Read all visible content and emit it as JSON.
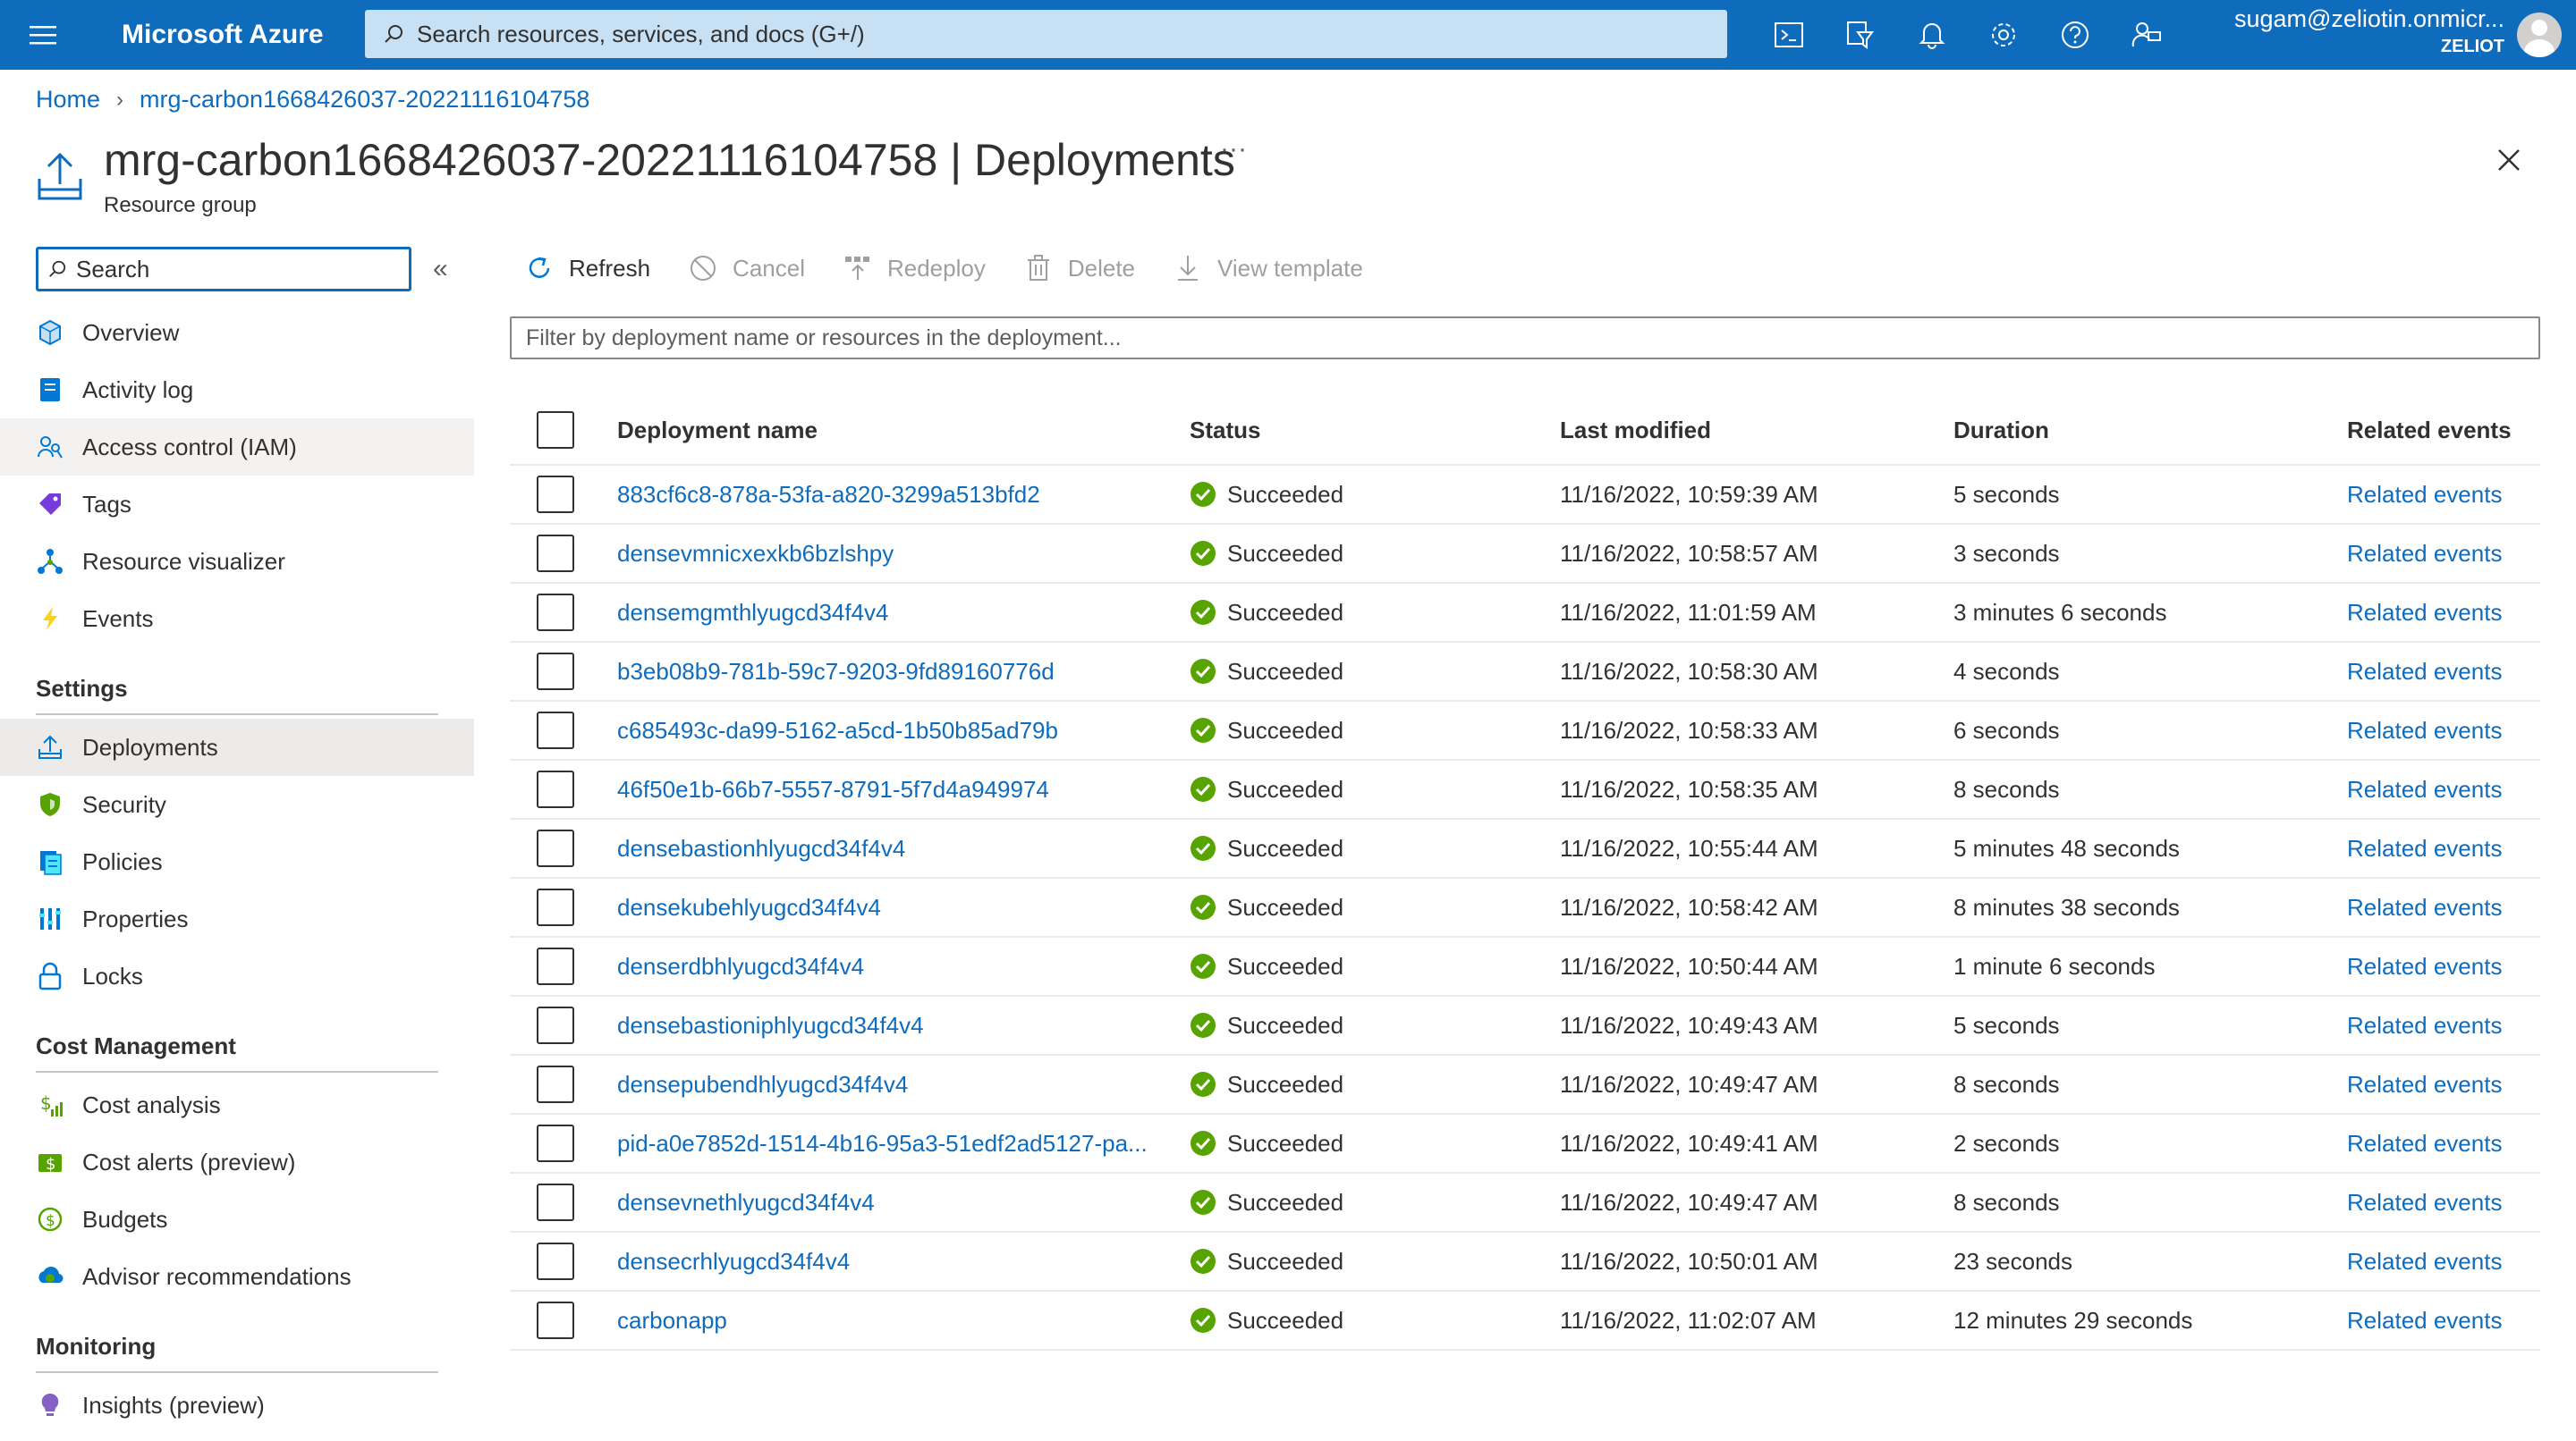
{
  "topbar": {
    "brand": "Microsoft Azure",
    "search_placeholder": "Search resources, services, and docs (G+/)",
    "icons": [
      "cloud-shell-icon",
      "directory-filter-icon",
      "notifications-icon",
      "settings-icon",
      "help-icon",
      "feedback-icon"
    ],
    "account_email": "sugam@zeliotin.onmicr...",
    "account_tenant": "ZELIOT"
  },
  "breadcrumb": {
    "home": "Home",
    "current": "mrg-carbon1668426037-20221116104758"
  },
  "header": {
    "title": "mrg-carbon1668426037-20221116104758 | Deployments",
    "subtitle": "Resource group",
    "more": "···"
  },
  "nav": {
    "search_placeholder": "Search",
    "collapse": "«",
    "items_top": [
      {
        "label": "Overview",
        "icon": "overview-icon"
      },
      {
        "label": "Activity log",
        "icon": "activity-log-icon"
      },
      {
        "label": "Access control (IAM)",
        "icon": "iam-icon"
      },
      {
        "label": "Tags",
        "icon": "tag-icon"
      },
      {
        "label": "Resource visualizer",
        "icon": "visualizer-icon"
      },
      {
        "label": "Events",
        "icon": "lightning-icon"
      }
    ],
    "settings_title": "Settings",
    "items_settings": [
      {
        "label": "Deployments",
        "icon": "deployments-icon"
      },
      {
        "label": "Security",
        "icon": "shield-icon"
      },
      {
        "label": "Policies",
        "icon": "policy-icon"
      },
      {
        "label": "Properties",
        "icon": "properties-icon"
      },
      {
        "label": "Locks",
        "icon": "lock-icon"
      }
    ],
    "cost_title": "Cost Management",
    "items_cost": [
      {
        "label": "Cost analysis",
        "icon": "cost-analysis-icon"
      },
      {
        "label": "Cost alerts (preview)",
        "icon": "cost-alerts-icon"
      },
      {
        "label": "Budgets",
        "icon": "budgets-icon"
      },
      {
        "label": "Advisor recommendations",
        "icon": "advisor-icon"
      }
    ],
    "monitoring_title": "Monitoring",
    "items_monitoring": [
      {
        "label": "Insights (preview)",
        "icon": "insights-icon"
      }
    ]
  },
  "toolbar": {
    "refresh": "Refresh",
    "cancel": "Cancel",
    "redeploy": "Redeploy",
    "delete": "Delete",
    "view_template": "View template"
  },
  "filter_placeholder": "Filter by deployment name or resources in the deployment...",
  "table": {
    "columns": [
      "Deployment name",
      "Status",
      "Last modified",
      "Duration",
      "Related events"
    ],
    "rows": [
      {
        "name": "883cf6c8-878a-53fa-a820-3299a513bfd2",
        "status": "Succeeded",
        "modified": "11/16/2022, 10:59:39 AM",
        "duration": "5 seconds",
        "events": "Related events"
      },
      {
        "name": "densevmnicxexkb6bzlshpy",
        "status": "Succeeded",
        "modified": "11/16/2022, 10:58:57 AM",
        "duration": "3 seconds",
        "events": "Related events"
      },
      {
        "name": "densemgmthlyugcd34f4v4",
        "status": "Succeeded",
        "modified": "11/16/2022, 11:01:59 AM",
        "duration": "3 minutes 6 seconds",
        "events": "Related events"
      },
      {
        "name": "b3eb08b9-781b-59c7-9203-9fd89160776d",
        "status": "Succeeded",
        "modified": "11/16/2022, 10:58:30 AM",
        "duration": "4 seconds",
        "events": "Related events"
      },
      {
        "name": "c685493c-da99-5162-a5cd-1b50b85ad79b",
        "status": "Succeeded",
        "modified": "11/16/2022, 10:58:33 AM",
        "duration": "6 seconds",
        "events": "Related events"
      },
      {
        "name": "46f50e1b-66b7-5557-8791-5f7d4a949974",
        "status": "Succeeded",
        "modified": "11/16/2022, 10:58:35 AM",
        "duration": "8 seconds",
        "events": "Related events"
      },
      {
        "name": "densebastionhlyugcd34f4v4",
        "status": "Succeeded",
        "modified": "11/16/2022, 10:55:44 AM",
        "duration": "5 minutes 48 seconds",
        "events": "Related events"
      },
      {
        "name": "densekubehlyugcd34f4v4",
        "status": "Succeeded",
        "modified": "11/16/2022, 10:58:42 AM",
        "duration": "8 minutes 38 seconds",
        "events": "Related events"
      },
      {
        "name": "denserdbhlyugcd34f4v4",
        "status": "Succeeded",
        "modified": "11/16/2022, 10:50:44 AM",
        "duration": "1 minute 6 seconds",
        "events": "Related events"
      },
      {
        "name": "densebastioniphlyugcd34f4v4",
        "status": "Succeeded",
        "modified": "11/16/2022, 10:49:43 AM",
        "duration": "5 seconds",
        "events": "Related events"
      },
      {
        "name": "densepubendhlyugcd34f4v4",
        "status": "Succeeded",
        "modified": "11/16/2022, 10:49:47 AM",
        "duration": "8 seconds",
        "events": "Related events"
      },
      {
        "name": "pid-a0e7852d-1514-4b16-95a3-51edf2ad5127-pa...",
        "status": "Succeeded",
        "modified": "11/16/2022, 10:49:41 AM",
        "duration": "2 seconds",
        "events": "Related events"
      },
      {
        "name": "densevnethlyugcd34f4v4",
        "status": "Succeeded",
        "modified": "11/16/2022, 10:49:47 AM",
        "duration": "8 seconds",
        "events": "Related events"
      },
      {
        "name": "densecrhlyugcd34f4v4",
        "status": "Succeeded",
        "modified": "11/16/2022, 10:50:01 AM",
        "duration": "23 seconds",
        "events": "Related events"
      },
      {
        "name": "carbonapp",
        "status": "Succeeded",
        "modified": "11/16/2022, 11:02:07 AM",
        "duration": "12 minutes 29 seconds",
        "events": "Related events"
      }
    ]
  },
  "colors": {
    "brand_blue": "#0f6cbd",
    "success_green": "#57a300",
    "link": "#0f6cbd"
  }
}
